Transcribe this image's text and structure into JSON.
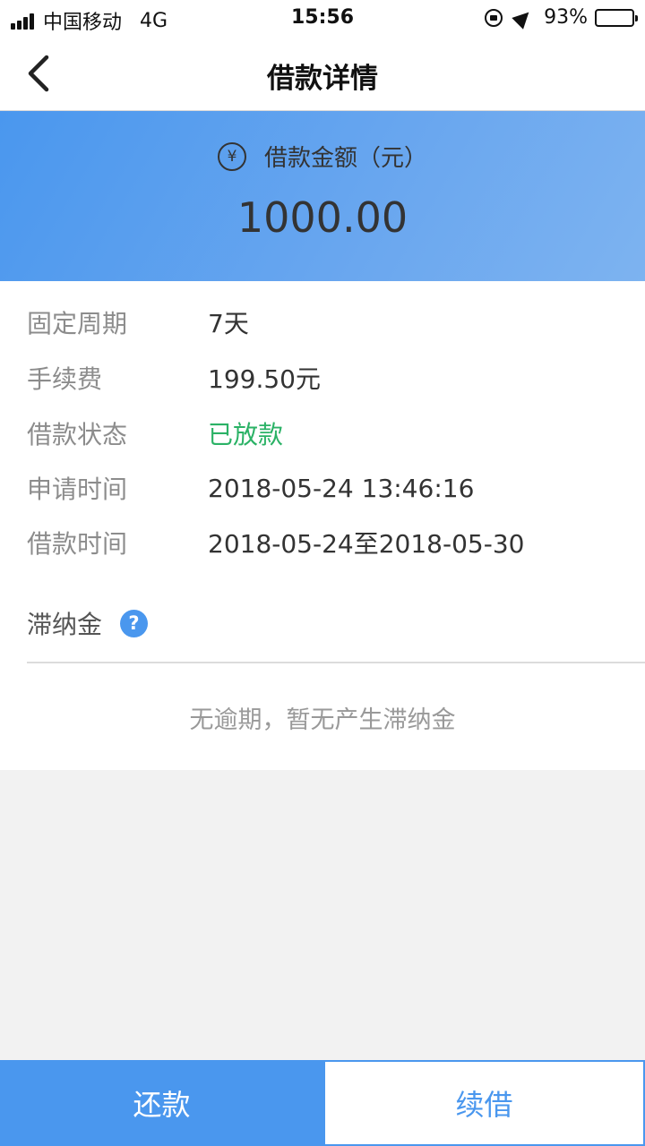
{
  "status_bar": {
    "carrier": "中国移动",
    "network": "4G",
    "time": "15:56",
    "battery": "93%",
    "battery_level": 0.93
  },
  "nav": {
    "title": "借款详情",
    "back_icon": "chevron-left-icon"
  },
  "hero": {
    "icon": "yen-icon",
    "currency_symbol": "¥",
    "label": "借款金额（元）",
    "amount": "1000.00"
  },
  "details": [
    {
      "label": "固定周期",
      "value": "7天"
    },
    {
      "label": "手续费",
      "value": "199.50元"
    },
    {
      "label": "借款状态",
      "value": "已放款"
    },
    {
      "label": "申请时间",
      "value": "2018-05-24 13:46:16"
    },
    {
      "label": "借款时间",
      "value": "2018-05-24至2018-05-30"
    }
  ],
  "late_fee": {
    "label": "滞纳金",
    "help_icon": "question-mark-icon",
    "help_symbol": "?",
    "empty_text": "无逾期，暂无产生滞纳金"
  },
  "actions": {
    "repay_label": "还款",
    "renew_label": "续借"
  },
  "colors": {
    "accent": "#4a97ee",
    "status_green": "#2bb266",
    "label_gray": "#8c8c8c",
    "background": "#f2f2f2"
  }
}
